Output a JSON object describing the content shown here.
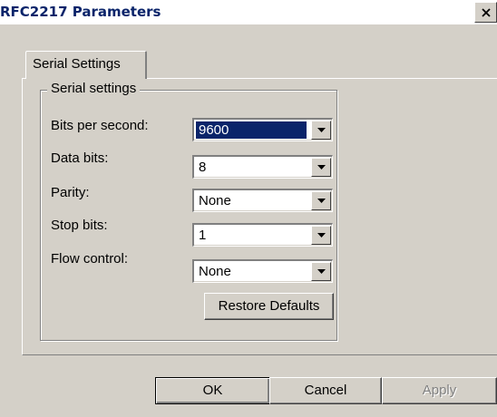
{
  "window": {
    "title": "RFC2217 Parameters"
  },
  "tabs": [
    {
      "label": "Serial Settings",
      "active": true
    }
  ],
  "group": {
    "title": "Serial settings"
  },
  "fields": {
    "bits_per_second": {
      "label": "Bits per second:",
      "value": "9600",
      "selected": true
    },
    "data_bits": {
      "label": "Data bits:",
      "value": "8"
    },
    "parity": {
      "label": "Parity:",
      "value": "None"
    },
    "stop_bits": {
      "label": "Stop bits:",
      "value": "1"
    },
    "flow_control": {
      "label": "Flow control:",
      "value": "None"
    }
  },
  "buttons": {
    "restore_defaults": "Restore Defaults",
    "ok": "OK",
    "cancel": "Cancel",
    "apply": "Apply"
  },
  "colors": {
    "face": "#d4d0c8",
    "selection": "#0a246a",
    "title_text": "#0a246a",
    "disabled_text": "#808080"
  },
  "icons": {
    "close": "close-icon",
    "dropdown": "chevron-down-icon"
  }
}
